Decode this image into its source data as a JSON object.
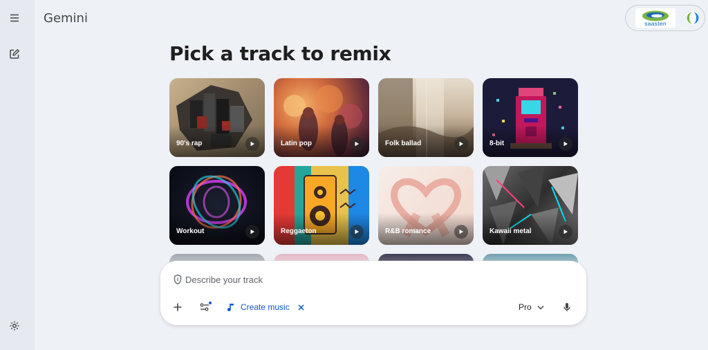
{
  "app": {
    "title": "Gemini"
  },
  "sidebar": {
    "menu_icon": "hamburger-menu-icon",
    "new_chat_icon": "edit-icon",
    "settings_icon": "gear-icon"
  },
  "account": {
    "logo_text": "saasten"
  },
  "main": {
    "heading": "Pick a track to remix",
    "tracks": [
      {
        "label": "90's rap",
        "icon": "play-icon"
      },
      {
        "label": "Latin pop",
        "icon": "play-icon"
      },
      {
        "label": "Folk ballad",
        "icon": "play-icon"
      },
      {
        "label": "8-bit",
        "icon": "play-icon"
      },
      {
        "label": "Workout",
        "icon": "play-icon"
      },
      {
        "label": "Reggaeton",
        "icon": "play-icon"
      },
      {
        "label": "R&B romance",
        "icon": "play-icon"
      },
      {
        "label": "Kawaii metal",
        "icon": "play-icon"
      }
    ]
  },
  "prompt": {
    "placeholder": "Describe your track",
    "tool_chip": {
      "label": "Create music",
      "icon": "music-note-icon"
    },
    "model_label": "Pro"
  },
  "colors": {
    "accent": "#0b57d0",
    "background": "#eef1f6",
    "sidebar": "#e6e9ef"
  }
}
